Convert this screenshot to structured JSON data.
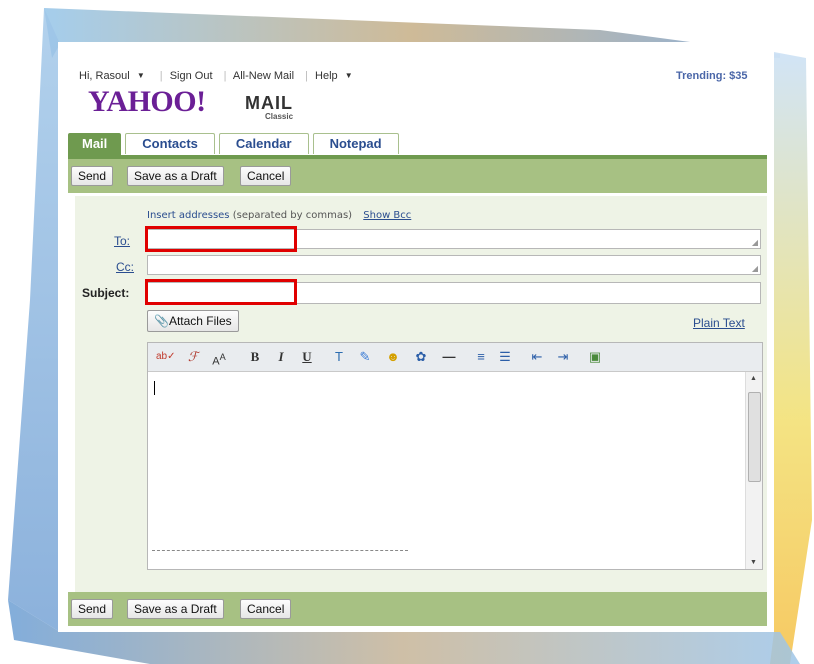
{
  "header": {
    "greeting": "Hi, Rasoul",
    "links": [
      "Sign Out",
      "All-New Mail",
      "Help"
    ],
    "trending": "Trending: $35",
    "logo_main": "YAHOO!",
    "logo_mail": "MAIL",
    "logo_classic": "Classic"
  },
  "tabs": [
    {
      "label": "Mail",
      "active": true
    },
    {
      "label": "Contacts",
      "active": false
    },
    {
      "label": "Calendar",
      "active": false
    },
    {
      "label": "Notepad",
      "active": false
    }
  ],
  "toolbar": {
    "send": "Send",
    "save_draft": "Save as a Draft",
    "cancel": "Cancel"
  },
  "compose": {
    "hint": "Insert addresses",
    "hint_extra": "(separated by commas)",
    "show_bcc": "Show Bcc",
    "to_label": "To:",
    "cc_label": "Cc:",
    "subject_label": "Subject:",
    "to_value": "",
    "cc_value": "",
    "subject_value": "",
    "attach_files": "Attach Files",
    "plain_text": "Plain Text",
    "body": ""
  },
  "editor_tools": [
    "spellcheck-icon",
    "font-family-icon",
    "font-size-icon",
    "bold-icon",
    "italic-icon",
    "underline-icon",
    "text-color-icon",
    "highlight-icon",
    "emoticon-icon",
    "stationery-icon",
    "horizontal-rule-icon",
    "align-icon",
    "bullet-list-icon",
    "outdent-icon",
    "indent-icon",
    "insert-image-icon"
  ],
  "colors": {
    "tab_green": "#6f9a4f",
    "toolbar_green": "#a7c183",
    "link_blue": "#2a4d8f",
    "highlight_red": "#e00000",
    "logo_purple": "#6b1f96"
  }
}
